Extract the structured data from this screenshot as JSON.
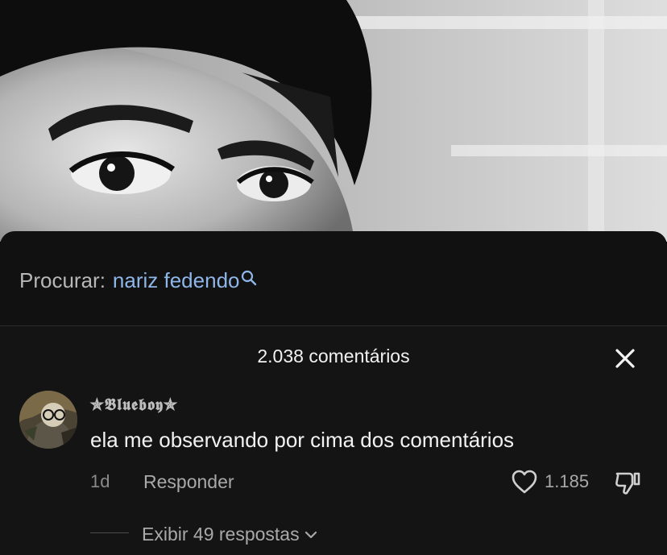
{
  "search": {
    "prefix": "Procurar:",
    "term": "nariz fedendo",
    "icon": "search-icon",
    "term_color": "#8fb6e8"
  },
  "comments": {
    "header": "2.038 comentários",
    "close_icon": "close-icon",
    "items": [
      {
        "username": "✯𝕭𝖑𝖚𝖊𝖇𝖔𝖞✯",
        "text": "ela me observando por cima dos comentários",
        "timestamp": "1d",
        "reply_label": "Responder",
        "like_count": "1.185",
        "like_icon": "heart-icon",
        "dislike_icon": "thumbs-down-icon",
        "view_replies_label": "Exibir 49 respostas"
      }
    ]
  },
  "colors": {
    "panel_bg": "#111111",
    "sheet_bg": "#141414",
    "primary_text": "#f2f2f2",
    "secondary_text": "#a9a9a9",
    "accent_link": "#8fb6e8"
  }
}
